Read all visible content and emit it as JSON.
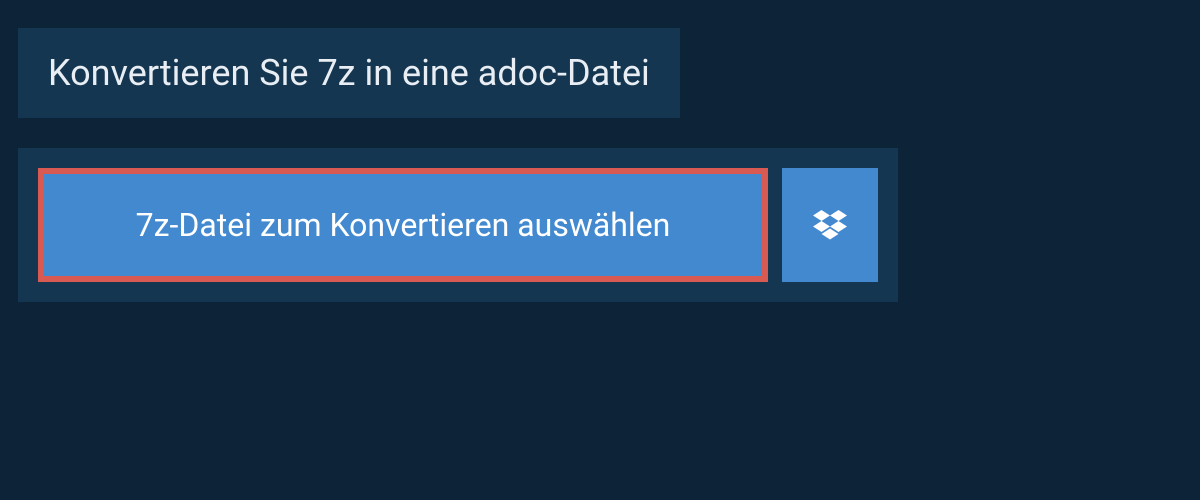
{
  "header": {
    "title": "Konvertieren Sie 7z in eine adoc-Datei"
  },
  "actions": {
    "select_file_label": "7z-Datei zum Konvertieren auswählen",
    "cloud_provider": "dropbox"
  },
  "colors": {
    "background": "#0d2438",
    "panel": "#143650",
    "button": "#4289d0",
    "highlight_border": "#d85a53"
  }
}
